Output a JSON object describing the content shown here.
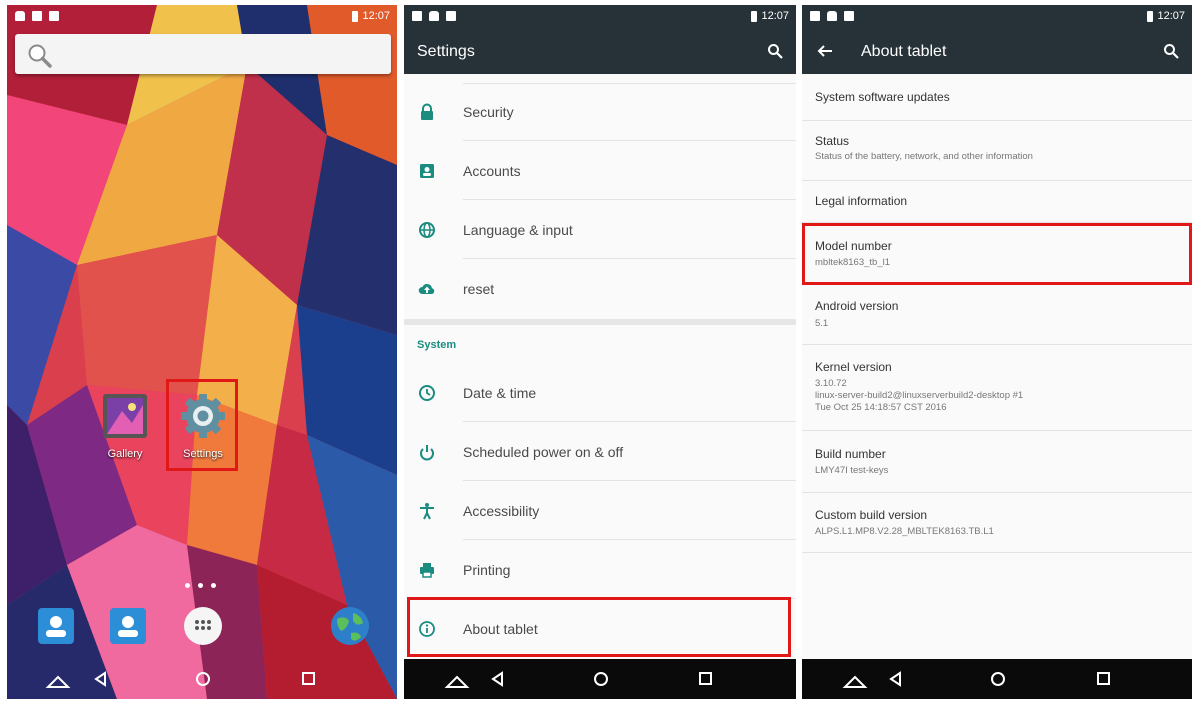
{
  "status_bar": {
    "time": "12:07"
  },
  "home": {
    "apps": [
      {
        "label": "Gallery",
        "icon": "gallery-icon"
      },
      {
        "label": "Settings",
        "icon": "gear-icon"
      }
    ],
    "dock": [
      "contacts-icon",
      "contacts-icon",
      "app-drawer-icon",
      "browser-globe-icon"
    ]
  },
  "settings": {
    "title": "Settings",
    "personal_items": [
      {
        "label": "Security",
        "icon": "lock-icon"
      },
      {
        "label": "Accounts",
        "icon": "account-icon"
      },
      {
        "label": "Language & input",
        "icon": "globe-icon"
      },
      {
        "label": "reset",
        "icon": "cloud-upload-icon"
      }
    ],
    "system_header": "System",
    "system_items": [
      {
        "label": "Date & time",
        "icon": "clock-icon"
      },
      {
        "label": "Scheduled power on & off",
        "icon": "power-icon"
      },
      {
        "label": "Accessibility",
        "icon": "accessibility-icon"
      },
      {
        "label": "Printing",
        "icon": "printer-icon"
      },
      {
        "label": "About tablet",
        "icon": "info-icon"
      }
    ]
  },
  "about": {
    "title": "About tablet",
    "items": [
      {
        "title": "System software updates",
        "summary": []
      },
      {
        "title": "Status",
        "summary": [
          "Status of the battery, network, and other information"
        ]
      },
      {
        "title": "Legal information",
        "summary": []
      },
      {
        "title": "Model number",
        "summary": [
          "mbltek8163_tb_l1"
        ]
      },
      {
        "title": "Android version",
        "summary": [
          "5.1"
        ]
      },
      {
        "title": "Kernel version",
        "summary": [
          "3.10.72",
          "linux-server-build2@linuxserverbuild2-desktop #1",
          "Tue Oct 25 14:18:57 CST 2016"
        ]
      },
      {
        "title": "Build number",
        "summary": [
          "LMY47I test-keys"
        ]
      },
      {
        "title": "Custom build version",
        "summary": [
          "ALPS.L1.MP8.V2.28_MBLTEK8163.TB.L1"
        ]
      }
    ]
  },
  "colors": {
    "app_bar": "#263238",
    "accent": "#1a8c80",
    "highlight": "#e01818"
  }
}
